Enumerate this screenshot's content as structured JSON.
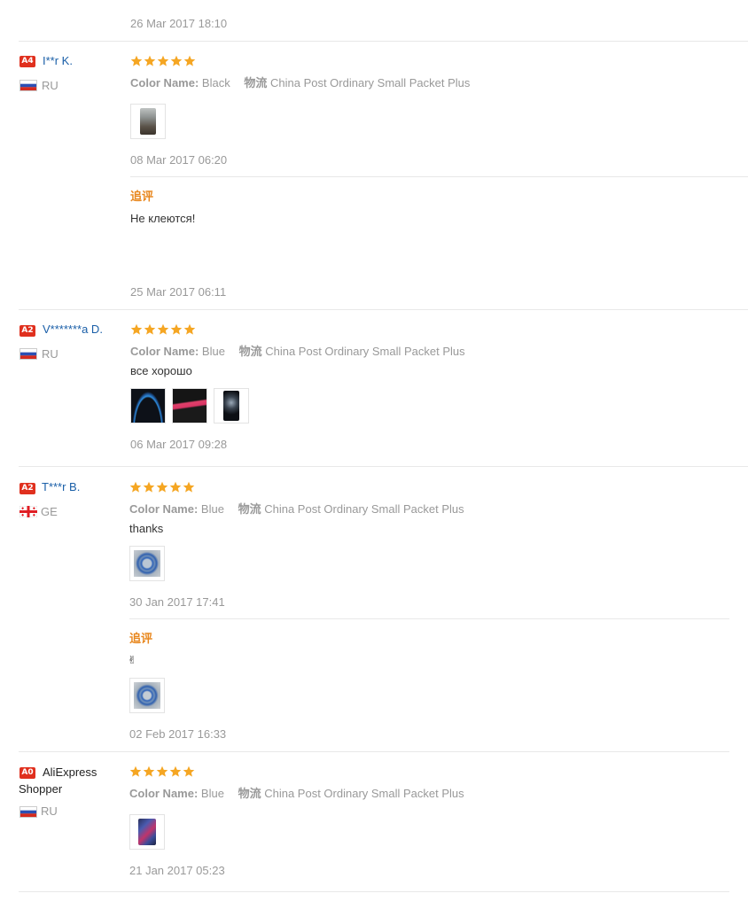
{
  "labels": {
    "color_name": "Color Name:",
    "shipping": "物流",
    "followup": "追评"
  },
  "colors": {
    "star": "#f5a623",
    "link": "#1a5fa8",
    "followup": "#e8871e",
    "badge": "#e0301e"
  },
  "top_date": "26 Mar 2017 18:10",
  "reviews": [
    {
      "level": "A4",
      "user": "I**r K.",
      "country": "RU",
      "flag": "russia-flag-icon",
      "stars": 5,
      "color": "Black",
      "shipping": "China Post Ordinary Small Packet Plus",
      "text": "",
      "photos": 1,
      "date": "08 Mar 2017 06:20",
      "followup": {
        "label": "追评",
        "text": "Не клеются!",
        "date": "25 Mar 2017 06:11"
      }
    },
    {
      "level": "A2",
      "user": "V*******a D.",
      "country": "RU",
      "flag": "russia-flag-icon",
      "stars": 5,
      "color": "Blue",
      "shipping": "China Post Ordinary Small Packet Plus",
      "text": "все хорошо",
      "photos": 3,
      "date": "06 Mar 2017 09:28"
    },
    {
      "level": "A2",
      "user": "T***r B.",
      "country": "GE",
      "flag": "georgia-flag-icon",
      "stars": 5,
      "color": "Blue",
      "shipping": "China Post Ordinary Small Packet Plus",
      "text": "thanks",
      "photos": 1,
      "date": "30 Jan 2017 17:41",
      "followup": {
        "label": "追评",
        "text": "✌",
        "photos": 1,
        "date": "02 Feb 2017 16:33"
      }
    },
    {
      "level": "A0",
      "user": "AliExpress Shopper",
      "country": "RU",
      "flag": "russia-flag-icon",
      "stars": 5,
      "color": "Blue",
      "shipping": "China Post Ordinary Small Packet Plus",
      "text": "",
      "photos": 1,
      "date": "21 Jan 2017 05:23"
    }
  ]
}
